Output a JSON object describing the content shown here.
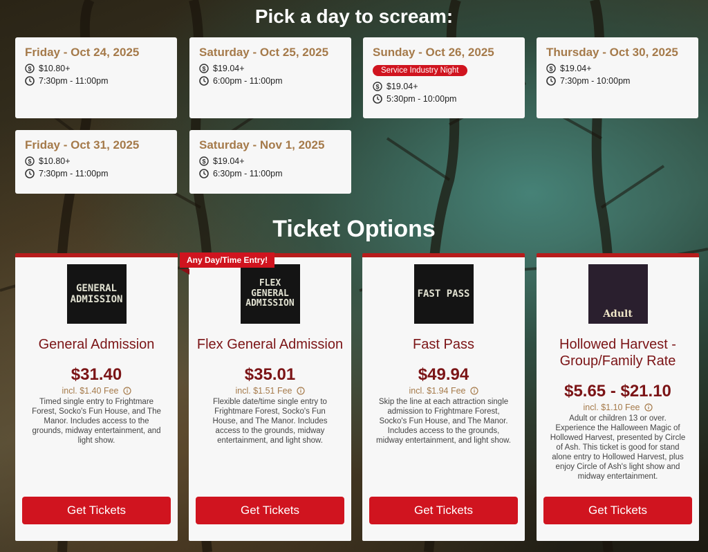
{
  "headings": {
    "pick_day": "Pick a day to scream:",
    "ticket_options": "Ticket Options"
  },
  "days": [
    {
      "date": "Friday - Oct 24, 2025",
      "price": "$10.80+",
      "time": "7:30pm - 11:00pm",
      "badge": ""
    },
    {
      "date": "Saturday - Oct 25, 2025",
      "price": "$19.04+",
      "time": "6:00pm - 11:00pm",
      "badge": ""
    },
    {
      "date": "Sunday - Oct 26, 2025",
      "price": "$19.04+",
      "time": "5:30pm - 10:00pm",
      "badge": "Service Industry Night"
    },
    {
      "date": "Thursday - Oct 30, 2025",
      "price": "$19.04+",
      "time": "7:30pm - 10:00pm",
      "badge": ""
    },
    {
      "date": "Friday - Oct 31, 2025",
      "price": "$10.80+",
      "time": "7:30pm - 11:00pm",
      "badge": ""
    },
    {
      "date": "Saturday - Nov 1, 2025",
      "price": "$19.04+",
      "time": "6:30pm - 11:00pm",
      "badge": ""
    }
  ],
  "ribbon": "Any Day/Time Entry!",
  "tickets": [
    {
      "image_text": "GENERAL ADMISSION",
      "name": "General Admission",
      "price": "$31.40",
      "fee": "incl. $1.40 Fee",
      "desc": "Timed single entry to Frightmare Forest, Socko's Fun House, and The Manor. Includes access to the grounds, midway entertainment, and light show.",
      "button": "Get Tickets"
    },
    {
      "image_text": "FLEX GENERAL ADMISSION",
      "name": "Flex General Admission",
      "price": "$35.01",
      "fee": "incl. $1.51 Fee",
      "desc": "Flexible date/time single entry to Frightmare Forest, Socko's Fun House, and The Manor. Includes access to the grounds, midway entertainment, and light show.",
      "button": "Get Tickets"
    },
    {
      "image_text": "FAST PASS",
      "name": "Fast Pass",
      "price": "$49.94",
      "fee": "incl. $1.94 Fee",
      "desc": "Skip the line at each attraction single admission to Frightmare Forest, Socko's Fun House, and The Manor. Includes access to the grounds, midway entertainment, and light show.",
      "button": "Get Tickets"
    },
    {
      "image_text": "Adult",
      "name": "Hollowed Harvest - Group/Family Rate",
      "price": "$5.65 - $21.10",
      "fee": "incl. $1.10 Fee",
      "desc": "Adult or children 13 or over. Experience the Halloween Magic of Hollowed Harvest, presented by Circle of Ash. This ticket is good for stand alone entry to Hollowed Harvest, plus enjoy Circle of Ash's light show and midway entertainment.",
      "button": "Get Tickets"
    }
  ],
  "icons": {
    "price": "dollar-circle-icon",
    "time": "clock-icon",
    "fee_info": "info-icon"
  },
  "colors": {
    "accent_red": "#d0141f",
    "title_red": "#7b1416",
    "date_brown": "#a57a4a"
  }
}
